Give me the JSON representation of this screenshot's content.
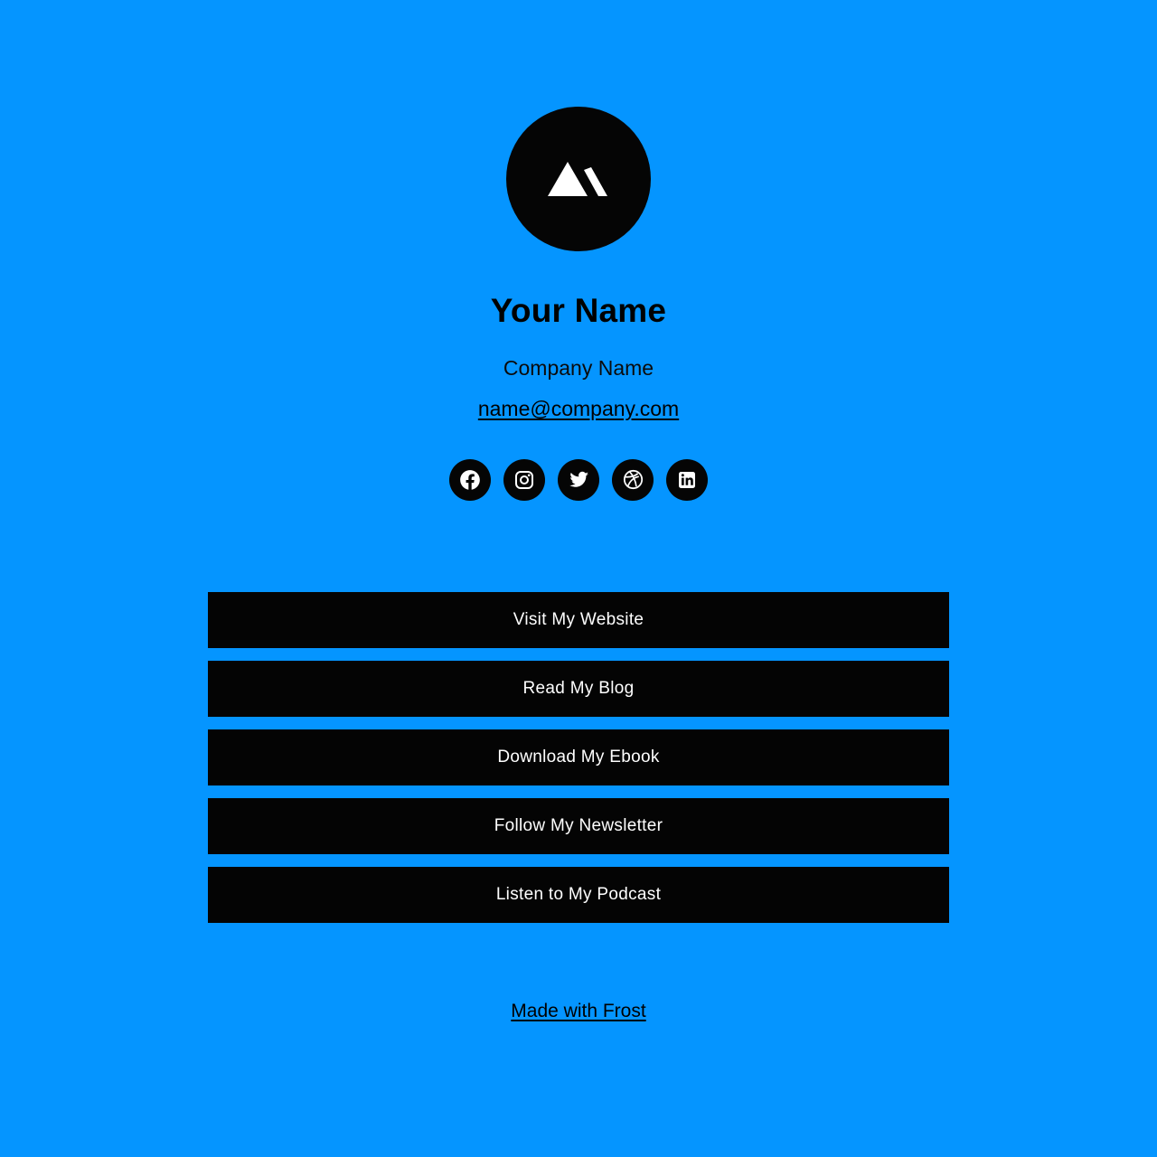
{
  "theme": {
    "background_color": "#0595ff",
    "button_color": "#040404",
    "button_text_color": "#ffffff",
    "text_color": "#000000"
  },
  "profile": {
    "avatar_icon": "mountain-logo-icon",
    "name": "Your Name",
    "company": "Company Name",
    "email": "name@company.com"
  },
  "socials": [
    {
      "id": "facebook",
      "icon": "facebook-icon",
      "label": "Facebook"
    },
    {
      "id": "instagram",
      "icon": "instagram-icon",
      "label": "Instagram"
    },
    {
      "id": "twitter",
      "icon": "twitter-icon",
      "label": "Twitter"
    },
    {
      "id": "dribbble",
      "icon": "dribbble-icon",
      "label": "Dribbble"
    },
    {
      "id": "linkedin",
      "icon": "linkedin-icon",
      "label": "LinkedIn"
    }
  ],
  "links": [
    {
      "label": "Visit My Website"
    },
    {
      "label": "Read My Blog"
    },
    {
      "label": "Download My Ebook"
    },
    {
      "label": "Follow My Newsletter"
    },
    {
      "label": "Listen to My Podcast"
    }
  ],
  "footer": {
    "label": "Made with Frost"
  }
}
